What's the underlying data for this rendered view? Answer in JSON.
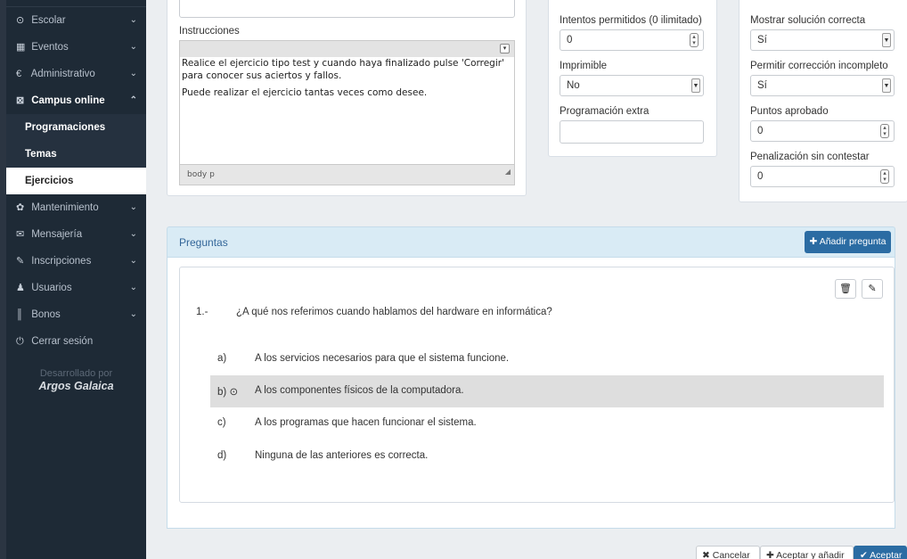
{
  "sidebar": {
    "items": [
      {
        "icon": "clock-icon",
        "glyph": "⊙",
        "label": "Escolar",
        "chevron": "⌄"
      },
      {
        "icon": "calendar-icon",
        "glyph": "▦",
        "label": "Eventos",
        "chevron": "⌄"
      },
      {
        "icon": "euro-icon",
        "glyph": "€",
        "label": "Administrativo",
        "chevron": "⌄"
      },
      {
        "icon": "edit-square-icon",
        "glyph": "⊠",
        "label": "Campus online",
        "chevron": "⌃"
      },
      {
        "icon": "gear-icon",
        "glyph": "✿",
        "label": "Mantenimiento",
        "chevron": "⌄"
      },
      {
        "icon": "envelope-icon",
        "glyph": "✉",
        "label": "Mensajería",
        "chevron": "⌄"
      },
      {
        "icon": "pencil-icon",
        "glyph": "✎",
        "label": "Inscripciones",
        "chevron": "⌄"
      },
      {
        "icon": "user-icon",
        "glyph": "♟",
        "label": "Usuarios",
        "chevron": "⌄"
      },
      {
        "icon": "barcode-icon",
        "glyph": "║",
        "label": "Bonos",
        "chevron": "⌄"
      },
      {
        "icon": "power-icon",
        "glyph": "⏻",
        "label": "Cerrar sesión"
      }
    ],
    "subitems": [
      "Programaciones",
      "Temas",
      "Ejercicios"
    ],
    "active_subitem": "Ejercicios",
    "credit_line": "Desarrollado por",
    "credit_brand": "Argos Galaica"
  },
  "form": {
    "instructions_label": "Instrucciones",
    "instructions_p1": "Realice el ejercicio tipo test y cuando haya finalizado pulse 'Corregir' para conocer sus aciertos y fallos.",
    "instructions_p2": "Puede realizar el ejercicio tantas veces como desee.",
    "editor_path": "body  p",
    "attempts_label": "Intentos permitidos (0 ilimitado)",
    "attempts_value": "0",
    "printable_label": "Imprimible",
    "printable_value": "No",
    "extra_label": "Programación extra",
    "extra_value": "",
    "show_solution_label": "Mostrar solución correcta",
    "show_solution_value": "Sí",
    "allow_incomplete_label": "Permitir corrección incompleto",
    "allow_incomplete_value": "Sí",
    "pass_points_label": "Puntos aprobado",
    "pass_points_value": "0",
    "penalty_label": "Penalización sin contestar",
    "penalty_value": "0"
  },
  "questions": {
    "title": "Preguntas",
    "add_label": "Añadir pregunta",
    "items": [
      {
        "number": "1.-",
        "text": "¿A qué nos referimos cuando hablamos del hardware en informática?",
        "answers": [
          {
            "letter": "a)",
            "text": "A los servicios necesarios para que el sistema funcione."
          },
          {
            "letter": "b)",
            "text": "A los componentes físicos de la computadora."
          },
          {
            "letter": "c)",
            "text": "A los programas que hacen funcionar el sistema."
          },
          {
            "letter": "d)",
            "text": "Ninguna de las anteriores es correcta."
          }
        ],
        "correct": "b)"
      }
    ]
  },
  "footer": {
    "cancel_label": "Cancelar",
    "accept_add_label": "Aceptar y añadir",
    "accept_label": "Aceptar"
  },
  "colors": {
    "sidebar_bg": "#1e2a36",
    "primary": "#2b6ca3",
    "panel_header": "#d9ebf5",
    "highlight_row": "#dedede"
  }
}
